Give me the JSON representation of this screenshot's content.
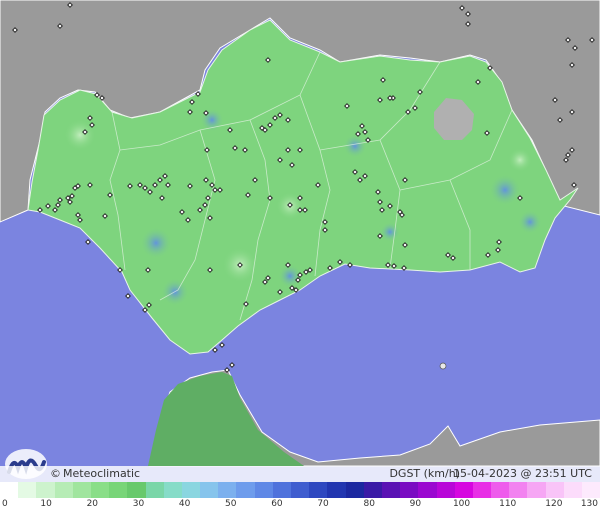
{
  "map": {
    "colors": {
      "sea": "#7b84e0",
      "land_outside": "#9a9a9a",
      "region": "#7ed47e",
      "region_border": "#e8f4e8",
      "morocco": "#5fae64",
      "highland": "#b0b0b0",
      "station_fill": "#ffffff",
      "station_stroke": "#1a1a1a",
      "gust_hotspot": "#6fa0e6"
    }
  },
  "info_bar": {
    "copyright_symbol": "©",
    "brand": "Meteoclimatic",
    "variable": "DGST (km/h)",
    "timestamp": "15-04-2023 @ 23:51 UTC"
  },
  "logo": {
    "icon": "meteoclimatic-m-logo-icon",
    "color": "#2a3c8c"
  },
  "scale": {
    "colors": [
      "#ffffff",
      "#e4fae4",
      "#cdf3cd",
      "#b6ecb5",
      "#a0e59e",
      "#8ade88",
      "#78d578",
      "#68c96c",
      "#7ad6a8",
      "#86dcc8",
      "#8ad6e0",
      "#86c4ec",
      "#7cb0ee",
      "#6e9cec",
      "#5f88e6",
      "#4f72dc",
      "#3f5dcf",
      "#2e48c0",
      "#2236b0",
      "#1c28a0",
      "#3a1aa6",
      "#5a12b4",
      "#7a0cc2",
      "#9a08d0",
      "#b806d8",
      "#d606e0",
      "#e82ee6",
      "#ee5cec",
      "#f282f0",
      "#f6a6f4",
      "#f9c4f8",
      "#fcdcfb",
      "#fdeafd"
    ],
    "labels": [
      "0",
      "10",
      "20",
      "30",
      "40",
      "50",
      "60",
      "70",
      "80",
      "90",
      "100",
      "110",
      "120",
      "130"
    ]
  }
}
